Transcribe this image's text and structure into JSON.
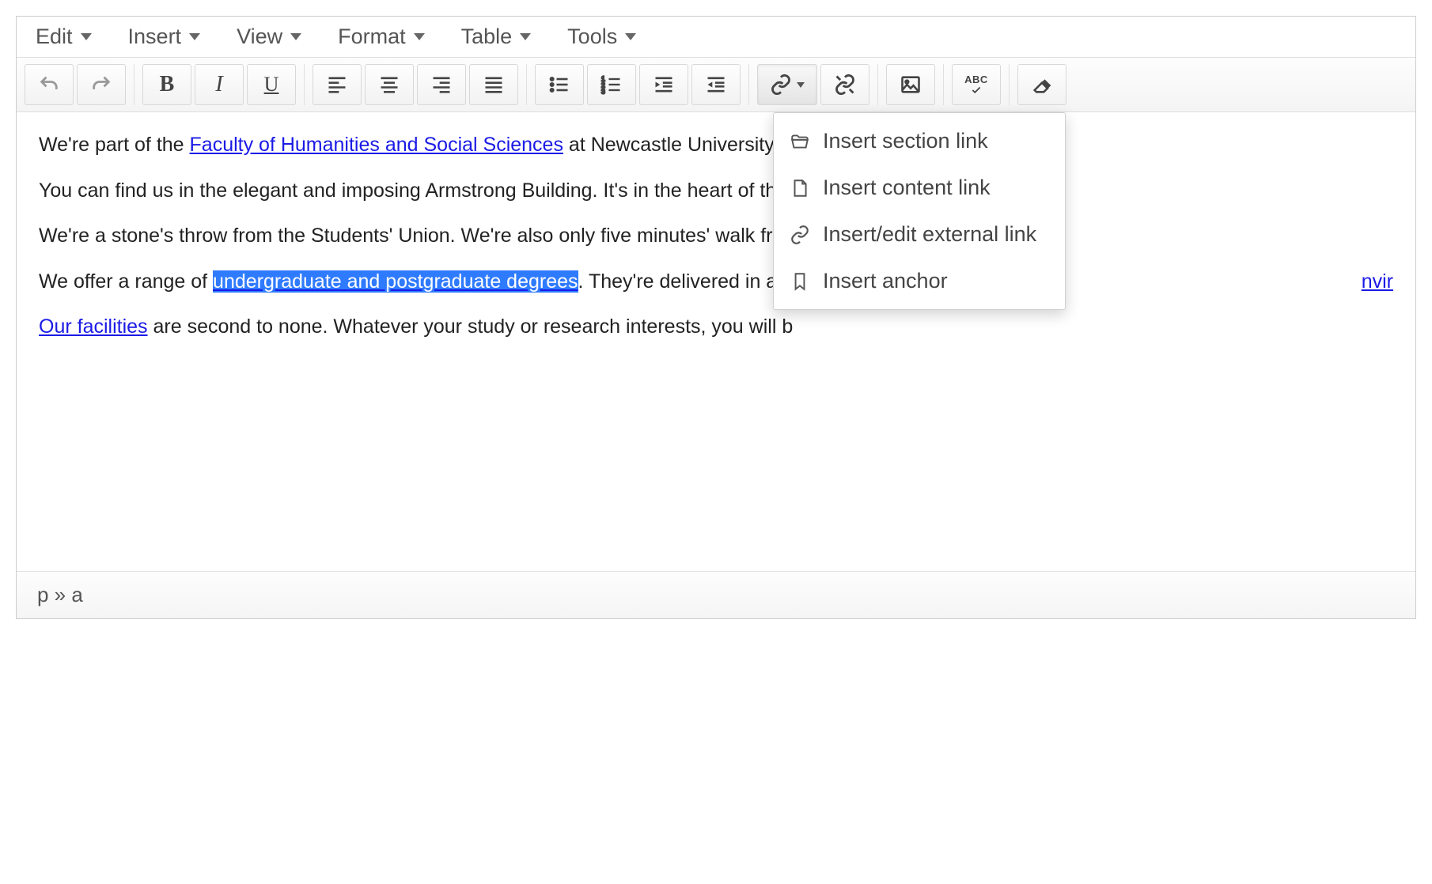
{
  "menubar": {
    "edit": "Edit",
    "insert": "Insert",
    "view": "View",
    "format": "Format",
    "table": "Table",
    "tools": "Tools"
  },
  "toolbar": {
    "bold": "B",
    "italic": "I",
    "underline": "U",
    "spellcheck": "ABC"
  },
  "dropdown": {
    "insert_section": "Insert section link",
    "insert_content": "Insert content link",
    "insert_external": "Insert/edit external link",
    "insert_anchor": "Insert anchor"
  },
  "content": {
    "p1_a": "We're part of the ",
    "p1_link": "Faculty of Humanities and Social Sciences",
    "p1_b": " at Newcastle University.",
    "p2": "You can find us in the elegant and imposing Armstrong Building. It's in the heart of the",
    "p3": "We're a stone's throw from the Students' Union. We're also only five minutes' walk fro",
    "p4_a": "We offer a range of ",
    "p4_sel": "undergraduate and postgraduate degrees",
    "p4_b": ". They're delivered in a w",
    "p4_tail": "nvir",
    "p5_link": "Our facilities",
    "p5_b": " are second to none. Whatever your study or research interests, you will b"
  },
  "statusbar": {
    "path": "p » a"
  }
}
